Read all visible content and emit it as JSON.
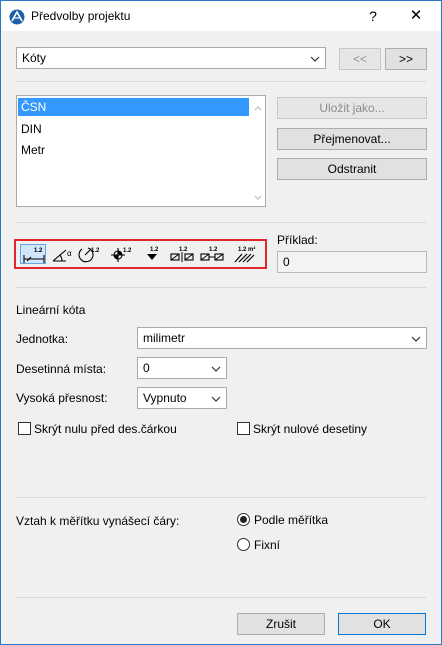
{
  "window": {
    "title": "Předvolby projektu",
    "help_glyph": "?",
    "close_glyph": "✕"
  },
  "top": {
    "category_value": "Kóty",
    "prev_label": "<<",
    "next_label": ">>"
  },
  "standards": {
    "items": [
      {
        "label": "ČSN",
        "selected": true
      },
      {
        "label": "DIN",
        "selected": false
      },
      {
        "label": "Metr",
        "selected": false
      }
    ],
    "save_as_label": "Uložit jako...",
    "rename_label": "Přejmenovat...",
    "delete_label": "Odstranit"
  },
  "toolbar": {
    "icons": [
      {
        "name": "linear-dimension-icon",
        "text": "1.2",
        "active": true
      },
      {
        "name": "angle-dimension-icon",
        "text": "α",
        "active": false
      },
      {
        "name": "radial-dimension-icon",
        "text": "1.2",
        "active": false
      },
      {
        "name": "level-dimension-icon",
        "text": "1.2",
        "active": false
      },
      {
        "name": "elevation-marker-icon",
        "text": "1.2",
        "active": false
      },
      {
        "name": "door-window-dimension-icon",
        "text": "1.2",
        "active": false
      },
      {
        "name": "sill-height-icon",
        "text": "1.2",
        "active": false
      },
      {
        "name": "area-calculation-icon",
        "text": "1.2 m²",
        "active": false
      }
    ]
  },
  "example": {
    "label": "Příklad:",
    "value": "0"
  },
  "linear": {
    "section_title": "Lineární kóta",
    "unit_label": "Jednotka:",
    "unit_value": "milimetr",
    "decimals_label": "Desetinná místa:",
    "decimals_value": "0",
    "precision_label": "Vysoká přesnost:",
    "precision_value": "Vypnuto",
    "hide_zero_before_label": "Skrýt nulu před des.čárkou",
    "hide_zero_decimals_label": "Skrýt nulové desetiny"
  },
  "scale": {
    "label": "Vztah k měřítku vynášecí čáry:",
    "option_scale": "Podle měřítka",
    "option_fixed": "Fixní",
    "selected": "scale"
  },
  "footer": {
    "cancel_label": "Zrušit",
    "ok_label": "OK"
  }
}
